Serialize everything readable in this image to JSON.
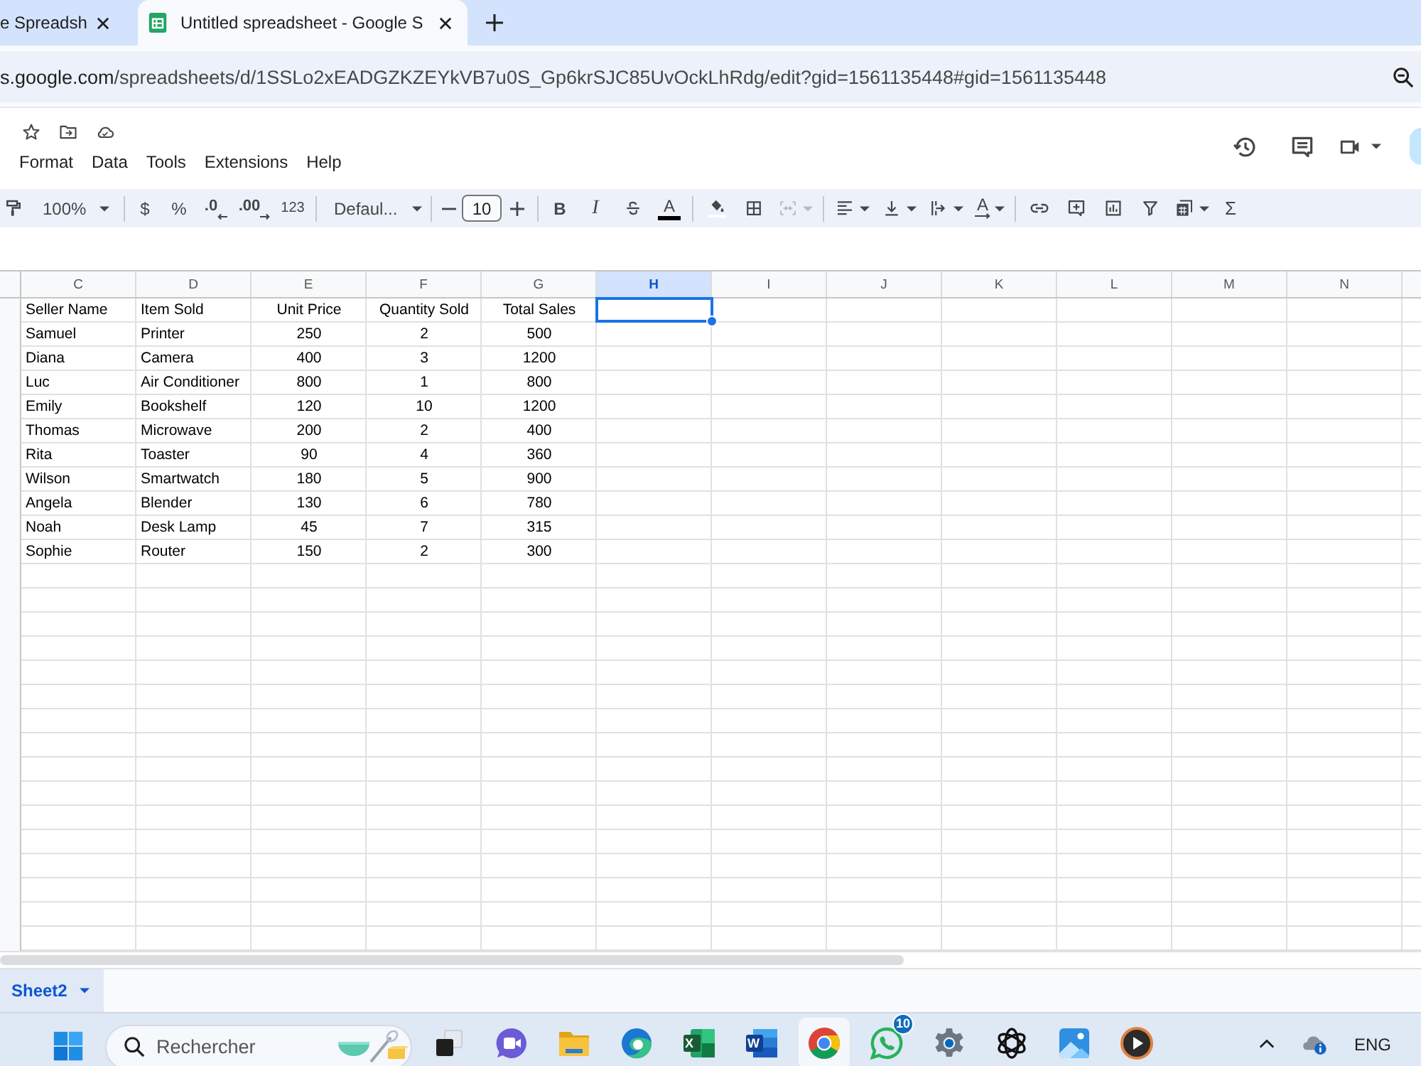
{
  "browser": {
    "tabs": [
      {
        "title": "e Spreadsh",
        "selected": false,
        "clipped": true
      },
      {
        "title": "Untitled spreadsheet - Google S",
        "selected": true,
        "clipped": false
      }
    ],
    "url": {
      "host": "s.google.com",
      "path": "/spreadsheets/d/1SSLo2xEADGZKZEYkVB7u0S_Gp6krSJC85UvOckLhRdg/edit?gid=1561135448#gid=1561135448"
    }
  },
  "menu": [
    "Format",
    "Data",
    "Tools",
    "Extensions",
    "Help"
  ],
  "toolbar": {
    "zoom": "100%",
    "currency": "$",
    "percent": "%",
    "decrease_decimal": ".0",
    "increase_decimal": ".00",
    "number_format": "123",
    "font": "Defaul...",
    "font_size": "10",
    "bold": "B",
    "italic": "I",
    "text_color": "A",
    "merge": {
      "disabled": true
    },
    "text_rotation": "A",
    "functions": "Σ"
  },
  "sheet": {
    "columns": [
      {
        "label": "C",
        "kind": "text",
        "selected": false
      },
      {
        "label": "D",
        "kind": "text",
        "selected": false
      },
      {
        "label": "E",
        "kind": "number",
        "selected": false
      },
      {
        "label": "F",
        "kind": "number",
        "selected": false
      },
      {
        "label": "G",
        "kind": "number",
        "selected": false
      },
      {
        "label": "H",
        "selected": true
      },
      {
        "label": "I",
        "selected": false
      },
      {
        "label": "J",
        "selected": false
      },
      {
        "label": "K",
        "selected": false
      },
      {
        "label": "L",
        "selected": false
      },
      {
        "label": "M",
        "selected": false
      },
      {
        "label": "N",
        "selected": false
      }
    ],
    "rows": [
      {
        "selected": true,
        "cells": [
          "Seller Name",
          "Item Sold",
          "Unit Price",
          "Quantity Sold",
          "Total Sales"
        ]
      },
      {
        "selected": false,
        "cells": [
          "Samuel",
          "Printer",
          "250",
          "2",
          "500"
        ]
      },
      {
        "selected": false,
        "cells": [
          "Diana",
          "Camera",
          "400",
          "3",
          "1200"
        ]
      },
      {
        "selected": false,
        "cells": [
          "Luc",
          "Air Conditioner",
          "800",
          "1",
          "800"
        ]
      },
      {
        "selected": false,
        "cells": [
          "Emily",
          "Bookshelf",
          "120",
          "10",
          "1200"
        ]
      },
      {
        "selected": false,
        "cells": [
          "Thomas",
          "Microwave",
          "200",
          "2",
          "400"
        ]
      },
      {
        "selected": false,
        "cells": [
          "Rita",
          "Toaster",
          "90",
          "4",
          "360"
        ]
      },
      {
        "selected": false,
        "cells": [
          "Wilson",
          "Smartwatch",
          "180",
          "5",
          "900"
        ]
      },
      {
        "selected": false,
        "cells": [
          "Angela",
          "Blender",
          "130",
          "6",
          "780"
        ]
      },
      {
        "selected": false,
        "cells": [
          "Noah",
          "Desk Lamp",
          "45",
          "7",
          "315"
        ]
      },
      {
        "selected": false,
        "cells": [
          "Sophie",
          "Router",
          "150",
          "2",
          "300"
        ]
      }
    ]
  },
  "sheet_tabs": [
    {
      "name": "Sheet2",
      "selected": true
    }
  ],
  "taskbar": {
    "search": {
      "placeholder": "Rechercher"
    },
    "apps": [
      {
        "selected": false
      },
      {
        "selected": false
      },
      {
        "selected": false
      },
      {
        "selected": false
      },
      {
        "selected": false,
        "letter": "X"
      },
      {
        "selected": false,
        "letter": "W"
      },
      {
        "selected": true
      },
      {
        "selected": false,
        "badge": "10"
      },
      {
        "selected": false
      },
      {
        "selected": false
      },
      {
        "selected": false
      },
      {
        "selected": false
      }
    ],
    "language": "ENG"
  }
}
